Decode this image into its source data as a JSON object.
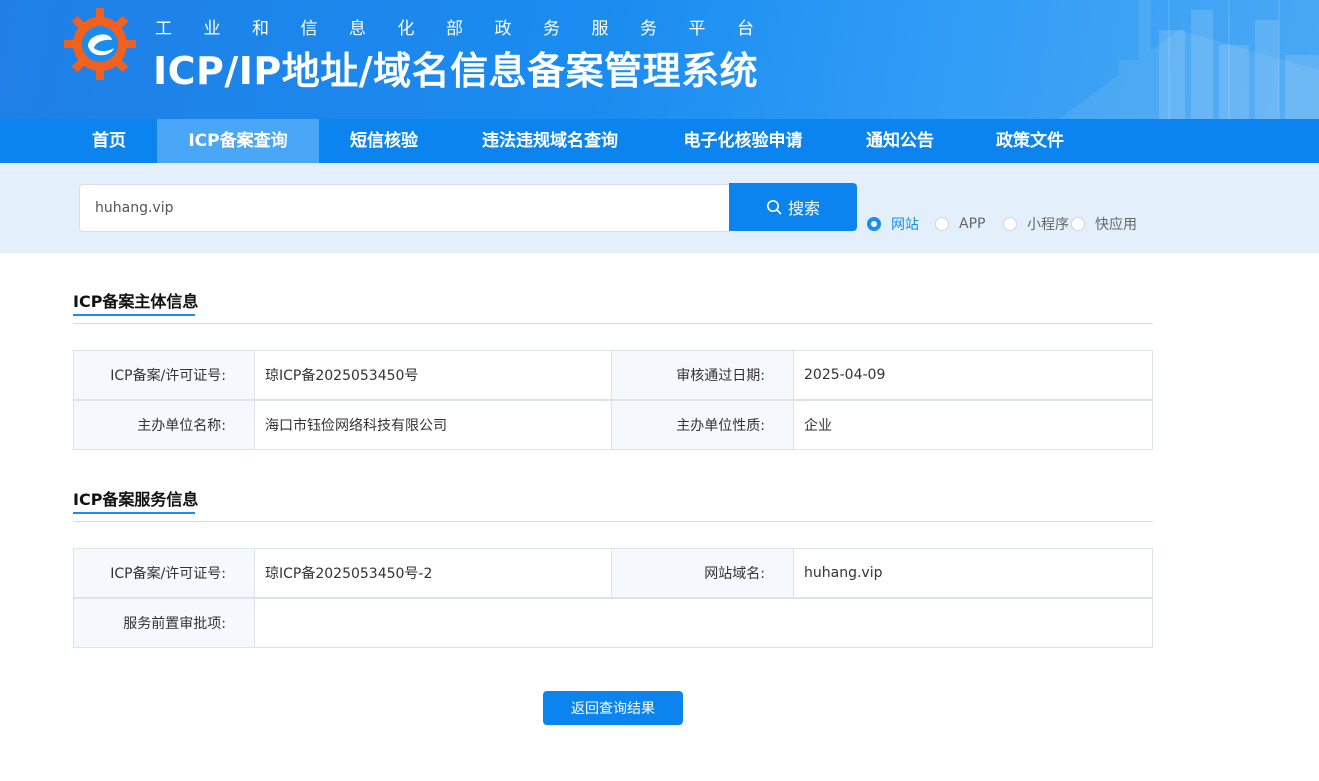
{
  "header": {
    "subtitle": "工业和信息化部政务服务平台",
    "title": "ICP/IP地址/域名信息备案管理系统"
  },
  "nav": {
    "items": [
      {
        "label": "首页"
      },
      {
        "label": "ICP备案查询",
        "active": true
      },
      {
        "label": "短信核验"
      },
      {
        "label": "违法违规域名查询"
      },
      {
        "label": "电子化核验申请"
      },
      {
        "label": "通知公告"
      },
      {
        "label": "政策文件"
      }
    ]
  },
  "search": {
    "value": "huhang.vip",
    "button_label": "搜索",
    "types": [
      {
        "label": "网站",
        "checked": true
      },
      {
        "label": "APP"
      },
      {
        "label": "小程序"
      },
      {
        "label": "快应用"
      }
    ]
  },
  "subject": {
    "title": "ICP备案主体信息",
    "license_label": "ICP备案/许可证号:",
    "license_value": "琼ICP备2025053450号",
    "date_label": "审核通过日期:",
    "date_value": "2025-04-09",
    "org_label": "主办单位名称:",
    "org_value": "海口市钰俭网络科技有限公司",
    "nature_label": "主办单位性质:",
    "nature_value": "企业"
  },
  "service": {
    "title": "ICP备案服务信息",
    "license_label": "ICP备案/许可证号:",
    "license_value": "琼ICP备2025053450号-2",
    "domain_label": "网站域名:",
    "domain_value": "huhang.vip",
    "approval_label": "服务前置审批项:",
    "approval_value": ""
  },
  "back_button_label": "返回查询结果",
  "colors": {
    "primary": "#0b84ef",
    "nav_active": "#4aa6f6",
    "search_band": "#e3f0fc",
    "logo_orange": "#f0601e"
  }
}
